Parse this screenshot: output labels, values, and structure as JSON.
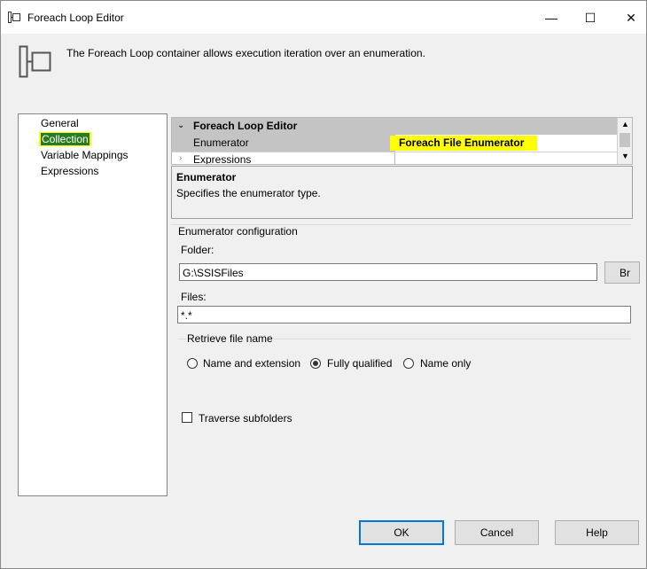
{
  "window": {
    "title": "Foreach Loop Editor",
    "description": "The Foreach Loop container allows execution iteration over an enumeration."
  },
  "nav": {
    "items": [
      {
        "label": "General"
      },
      {
        "label": "Collection"
      },
      {
        "label": "Variable Mappings"
      },
      {
        "label": "Expressions"
      }
    ],
    "selected": "Collection"
  },
  "grid": {
    "category": "Foreach Loop Editor",
    "rows": [
      {
        "name": "Enumerator",
        "value": "Foreach File Enumerator"
      },
      {
        "name": "Expressions",
        "value": ""
      }
    ]
  },
  "property_desc": {
    "title": "Enumerator",
    "text": "Specifies the enumerator type."
  },
  "config": {
    "section_title": "Enumerator configuration",
    "folder_label": "Folder:",
    "folder_value": "G:\\SSISFiles",
    "browse_label": "Br",
    "files_label": "Files:",
    "files_value": "*.*",
    "retrieve_group": "Retrieve file name",
    "options": [
      {
        "label": "Name and extension",
        "selected": false
      },
      {
        "label": "Fully qualified",
        "selected": true
      },
      {
        "label": "Name only",
        "selected": false
      }
    ],
    "traverse_label": "Traverse subfolders",
    "traverse_checked": false
  },
  "buttons": {
    "ok": "OK",
    "cancel": "Cancel",
    "help": "Help"
  },
  "colors": {
    "highlight": "#ffff00",
    "selected_nav_bg": "#2a7a1f",
    "default_button_border": "#0078d7"
  }
}
